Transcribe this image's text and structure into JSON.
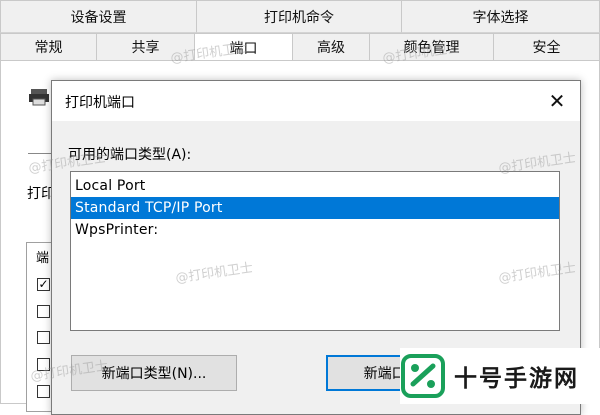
{
  "tabs": {
    "row1": [
      "设备设置",
      "打印机命令",
      "字体选择"
    ],
    "row2": [
      "常规",
      "共享",
      "端口",
      "高级",
      "颜色管理",
      "安全"
    ],
    "active": "端口"
  },
  "background": {
    "print_label": "打印",
    "list_header": "端"
  },
  "dialog": {
    "title": "打印机端口",
    "close": "✕",
    "available_label": "可用的端口类型(A):",
    "ports": [
      "Local Port",
      "Standard TCP/IP Port",
      "WpsPrinter:"
    ],
    "selected_port": "Standard TCP/IP Port",
    "new_port_type_button": "新端口类型(N)...",
    "new_port_button": "新端口(P)..."
  },
  "watermark": "@打印机卫士",
  "logo": {
    "text": "十号手游网",
    "color": "#1aa05a"
  },
  "colors": {
    "selection": "#0078d7",
    "dialog_bg": "#f0f0f0"
  }
}
